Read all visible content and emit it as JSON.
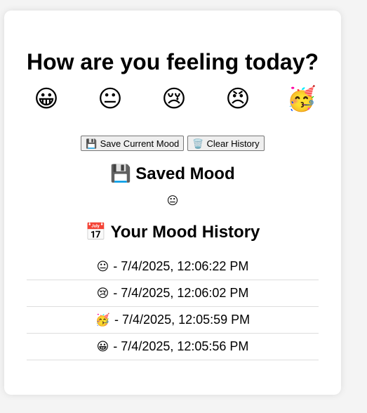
{
  "title": "How are you feeling today?",
  "moods": [
    {
      "emoji": "😀",
      "icon": "grinning-face-icon"
    },
    {
      "emoji": "😐",
      "icon": "neutral-face-icon"
    },
    {
      "emoji": "😢",
      "icon": "crying-face-icon"
    },
    {
      "emoji": "😠",
      "icon": "angry-face-icon"
    },
    {
      "emoji": "🥳",
      "icon": "party-face-icon"
    }
  ],
  "actions": {
    "save": {
      "icon": "💾",
      "label": "Save Current Mood"
    },
    "clear": {
      "icon": "🗑️",
      "label": "Clear History"
    }
  },
  "saved": {
    "icon": "💾",
    "heading": "Saved Mood",
    "value": "😐"
  },
  "history": {
    "icon": "📅",
    "heading": "Your Mood History",
    "entries": [
      {
        "emoji": "😐",
        "text": "- 7/4/2025, 12:06:22 PM"
      },
      {
        "emoji": "😢",
        "text": "- 7/4/2025, 12:06:02 PM"
      },
      {
        "emoji": "🥳",
        "text": "- 7/4/2025, 12:05:59 PM"
      },
      {
        "emoji": "😀",
        "text": "- 7/4/2025, 12:05:56 PM"
      }
    ]
  }
}
